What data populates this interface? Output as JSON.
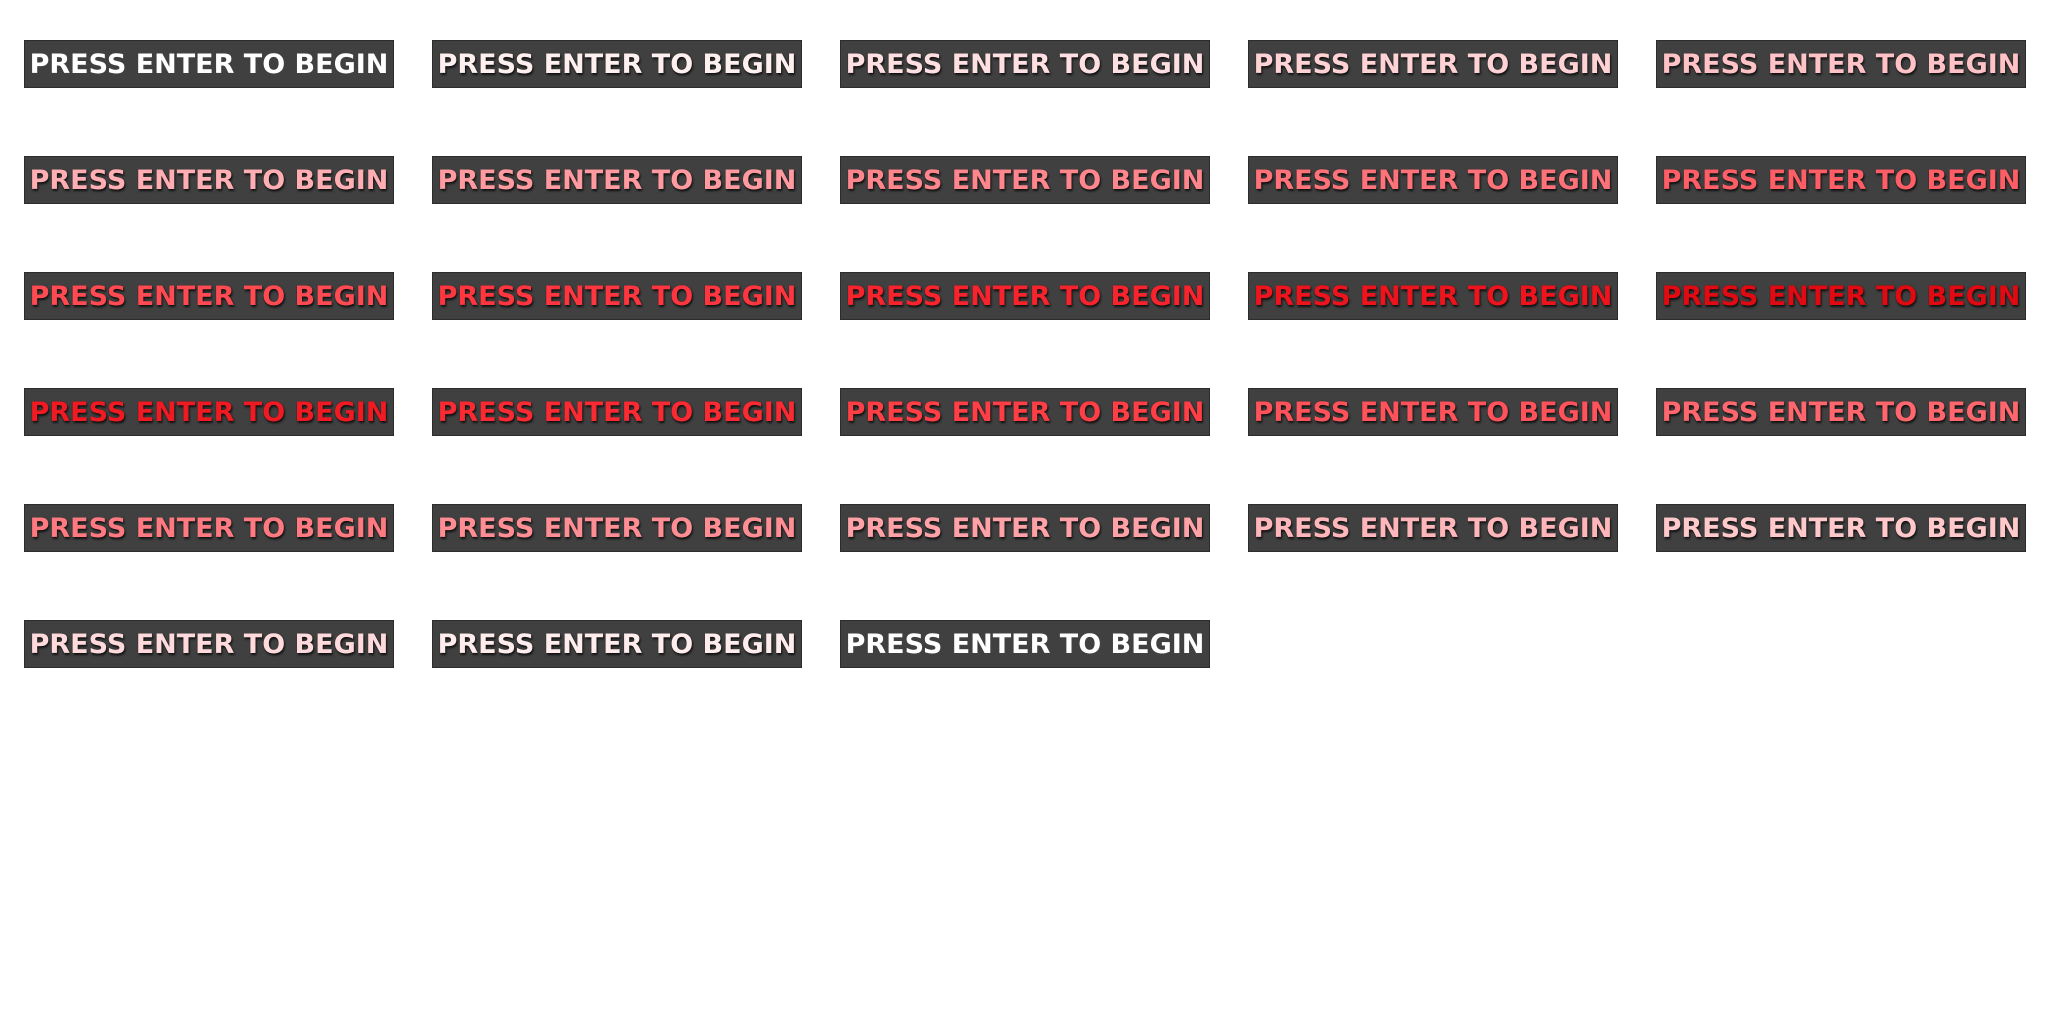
{
  "prompt_text": "PRESS ENTER TO BEGIN",
  "colors": {
    "panel": "#404040",
    "panel_border": "#2c2c2c",
    "background": "#ffffff"
  },
  "frames": [
    {
      "color": "#ffffff"
    },
    {
      "color": "#fff0f0"
    },
    {
      "color": "#ffe0e2"
    },
    {
      "color": "#ffd2d5"
    },
    {
      "color": "#ffc2c6"
    },
    {
      "color": "#ffaeb3"
    },
    {
      "color": "#ff9aa0"
    },
    {
      "color": "#ff868d"
    },
    {
      "color": "#ff727a"
    },
    {
      "color": "#ff5e66"
    },
    {
      "color": "#ff4a52"
    },
    {
      "color": "#ff363f"
    },
    {
      "color": "#f8242d"
    },
    {
      "color": "#ee141d"
    },
    {
      "color": "#e00a12"
    },
    {
      "color": "#f01a22"
    },
    {
      "color": "#fa2a32"
    },
    {
      "color": "#ff3e46"
    },
    {
      "color": "#ff525a"
    },
    {
      "color": "#ff666d"
    },
    {
      "color": "#ff7a80"
    },
    {
      "color": "#ff8e94"
    },
    {
      "color": "#ffa2a7"
    },
    {
      "color": "#ffb6ba"
    },
    {
      "color": "#ffc8cb"
    },
    {
      "color": "#ffdadc"
    },
    {
      "color": "#ffeced"
    },
    {
      "color": "#ffffff"
    }
  ]
}
